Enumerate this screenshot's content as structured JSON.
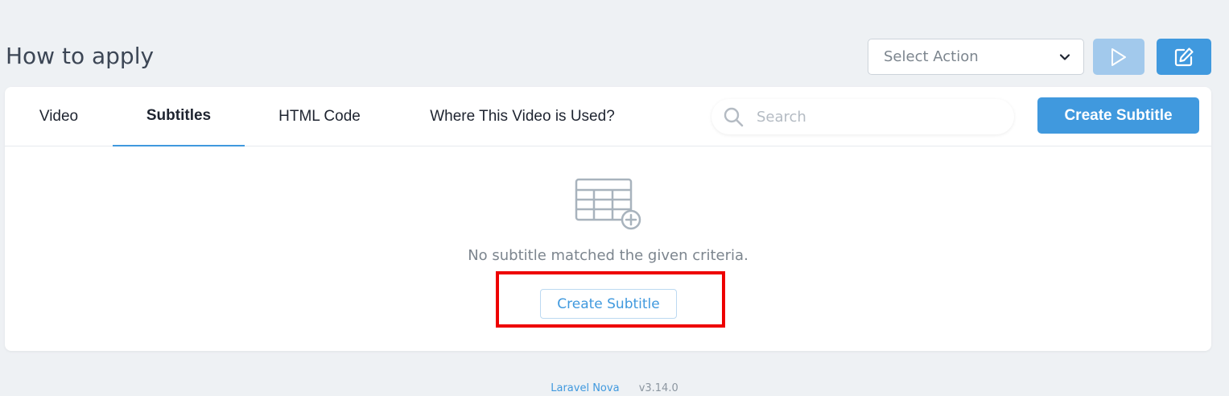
{
  "page": {
    "title": "How to apply"
  },
  "actions": {
    "select_placeholder": "Select Action"
  },
  "tabs": [
    {
      "label": "Video"
    },
    {
      "label": "Subtitles"
    },
    {
      "label": "HTML Code"
    },
    {
      "label": "Where This Video is Used?"
    }
  ],
  "active_tab": "Subtitles",
  "search": {
    "placeholder": "Search",
    "value": ""
  },
  "toolbar": {
    "create_label": "Create Subtitle"
  },
  "empty_state": {
    "message": "No subtitle matched the given criteria.",
    "create_label": "Create Subtitle"
  },
  "footer": {
    "brand": "Laravel Nova",
    "version": "v3.14.0"
  },
  "icons": {
    "select_chevron": "chevron-down-icon",
    "run": "play-icon",
    "edit": "edit-icon",
    "search": "search-icon",
    "empty": "table-add-icon"
  },
  "colors": {
    "primary": "#4099de",
    "primary_disabled": "#a2c9ec",
    "highlight": "#ee0000",
    "background": "#eef1f4",
    "text_muted": "#7c858e"
  }
}
